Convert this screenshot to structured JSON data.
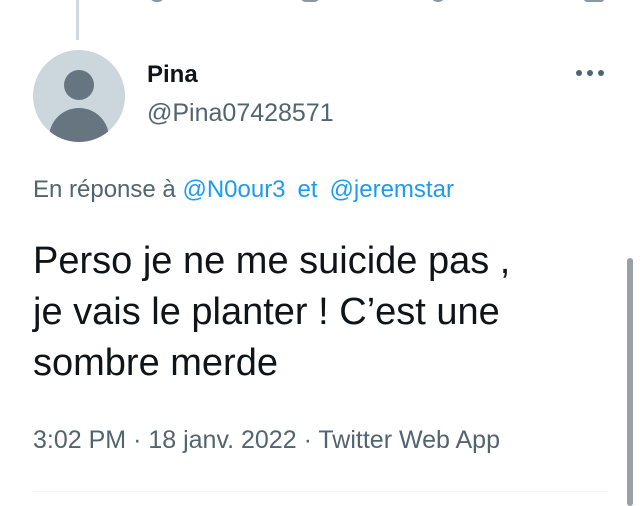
{
  "tweet": {
    "display_name": "Pina",
    "handle": "@Pina07428571",
    "reply_prefix": "En réponse à",
    "reply_mentions": [
      "@N0our3",
      "@jeremstar"
    ],
    "reply_conjunction": "et",
    "text_lines": [
      "Perso je ne me suicide pas ,",
      "je vais le planter ! C’est une",
      "sombre merde"
    ],
    "time": "3:02 PM",
    "date": "18 janv. 2022",
    "source": "Twitter Web App",
    "separator": "·"
  },
  "colors": {
    "text_primary": "#0f1419",
    "text_secondary": "#536471",
    "link": "#1d9bf0",
    "avatar_bg": "#ccd6dd",
    "avatar_fg": "#66757f"
  },
  "icons": {
    "avatar": "default-profile-icon",
    "more": "more-options-icon"
  }
}
